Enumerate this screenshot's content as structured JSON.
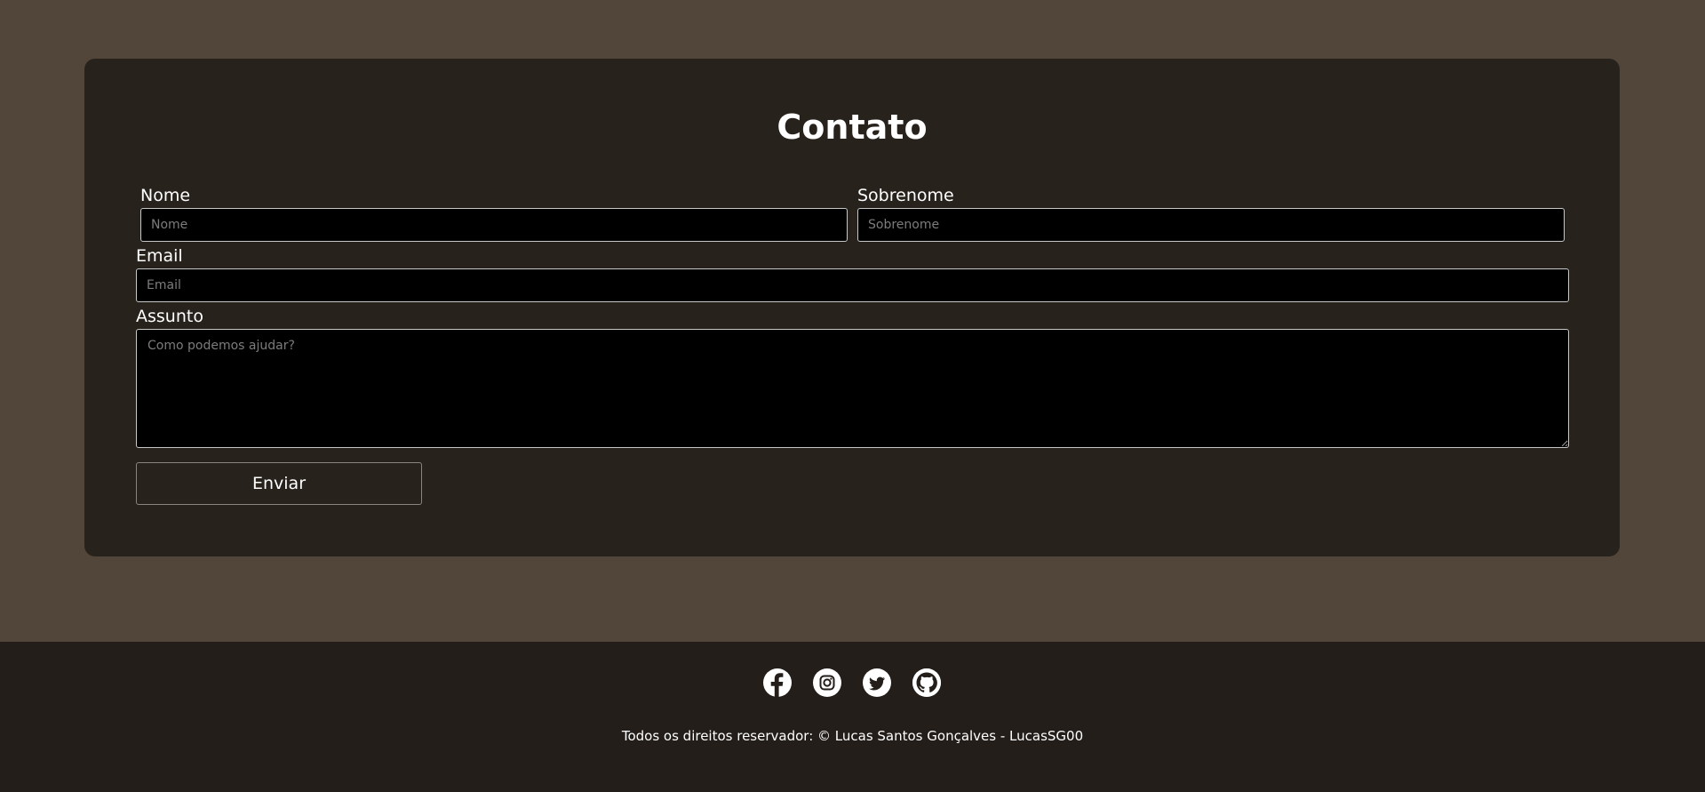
{
  "contact": {
    "title": "Contato",
    "first_name": {
      "label": "Nome",
      "placeholder": "Nome",
      "value": ""
    },
    "last_name": {
      "label": "Sobrenome",
      "placeholder": "Sobrenome",
      "value": ""
    },
    "email": {
      "label": "Email",
      "placeholder": "Email",
      "value": ""
    },
    "subject": {
      "label": "Assunto",
      "placeholder": "Como podemos ajudar?",
      "value": ""
    },
    "submit_label": "Enviar"
  },
  "footer": {
    "social_icons": [
      "facebook-icon",
      "instagram-icon",
      "twitter-icon",
      "github-icon"
    ],
    "copyright": "Todos os direitos reservador: © Lucas Santos Gonçalves - LucasSG00"
  },
  "colors": {
    "page_background": "#52463a",
    "card_background": "#28221d",
    "footer_background": "#231e1a",
    "field_background": "#000000",
    "text": "#ffffff"
  }
}
